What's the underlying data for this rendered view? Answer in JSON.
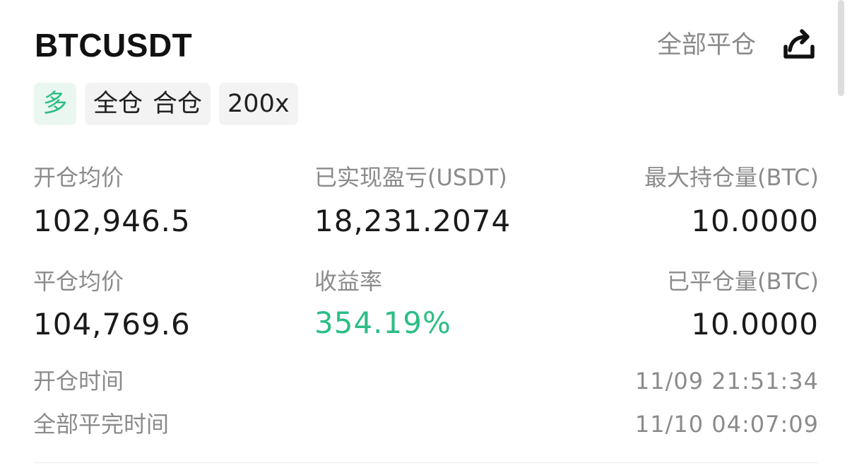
{
  "header": {
    "symbol": "BTCUSDT",
    "close_all_label": "全部平仓",
    "share_icon": "share-icon"
  },
  "tags": {
    "side": "多",
    "margin_mode_1": "全仓",
    "margin_mode_2": "合仓",
    "leverage": "200x"
  },
  "stats": {
    "avg_open_price": {
      "label": "开仓均价",
      "value": "102,946.5"
    },
    "realized_pnl": {
      "label": "已实现盈亏(USDT)",
      "value": "18,231.2074"
    },
    "max_position": {
      "label": "最大持仓量(BTC)",
      "value": "10.0000"
    },
    "avg_close_price": {
      "label": "平仓均价",
      "value": "104,769.6"
    },
    "roi": {
      "label": "收益率",
      "value": "354.19%"
    },
    "closed_amount": {
      "label": "已平仓量(BTC)",
      "value": "10.0000"
    }
  },
  "times": {
    "open_time": {
      "label": "开仓时间",
      "value": "11/09 21:51:34"
    },
    "close_time": {
      "label": "全部平完时间",
      "value": "11/10 04:07:09"
    }
  },
  "colors": {
    "profit_green": "#2dbd85",
    "label_gray": "#8b8b8b",
    "text_dark": "#1a1a1a"
  }
}
